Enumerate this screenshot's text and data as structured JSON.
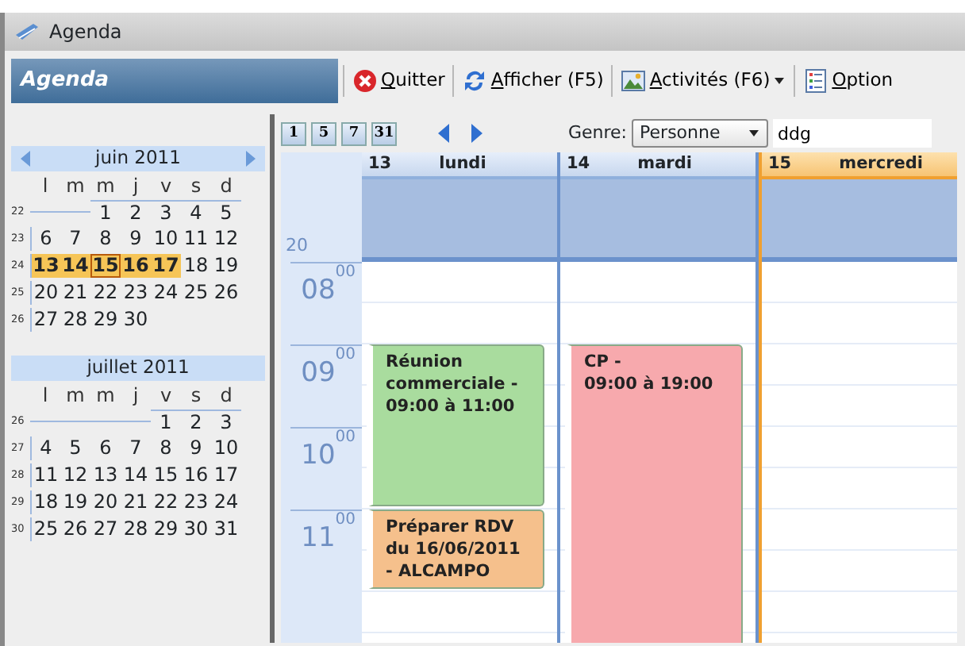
{
  "window": {
    "title": "Agenda"
  },
  "panel_title": "Agenda",
  "toolbar": [
    {
      "label": "Quitter",
      "kind": "quit"
    },
    {
      "label": "Afficher (F5)",
      "kind": "refresh"
    },
    {
      "label": "Activités  (F6)",
      "kind": "activities",
      "dropdown": true
    },
    {
      "label": "Option",
      "kind": "options"
    }
  ],
  "mini_calendars": [
    {
      "title": "juin 2011",
      "navigation": true,
      "weekdays": [
        "l",
        "m",
        "m",
        "j",
        "v",
        "s",
        "d"
      ],
      "weeks": [
        {
          "number": "22",
          "kind": "right_aligned",
          "days": [
            {
              "day": "1",
              "selected": false,
              "today": false
            },
            {
              "day": "2",
              "selected": false,
              "today": false
            },
            {
              "day": "3",
              "selected": false,
              "today": false
            },
            {
              "day": "4",
              "selected": false,
              "today": false
            },
            {
              "day": "5",
              "selected": false,
              "today": false
            }
          ]
        },
        {
          "number": "23",
          "days": [
            {
              "day": "6",
              "selected": false,
              "today": false
            },
            {
              "day": "7",
              "selected": false,
              "today": false
            },
            {
              "day": "8",
              "selected": false,
              "today": false
            },
            {
              "day": "9",
              "selected": false,
              "today": false
            },
            {
              "day": "10",
              "selected": false,
              "today": false
            },
            {
              "day": "11",
              "selected": false,
              "today": false
            },
            {
              "day": "12",
              "selected": false,
              "today": false
            }
          ]
        },
        {
          "number": "24",
          "days": [
            {
              "day": "13",
              "selected": true,
              "today": false
            },
            {
              "day": "14",
              "selected": true,
              "today": false
            },
            {
              "day": "15",
              "selected": true,
              "today": true
            },
            {
              "day": "16",
              "selected": true,
              "today": false
            },
            {
              "day": "17",
              "selected": true,
              "today": false
            },
            {
              "day": "18",
              "selected": false,
              "today": false
            },
            {
              "day": "19",
              "selected": false,
              "today": false
            }
          ]
        },
        {
          "number": "25",
          "days": [
            {
              "day": "20",
              "selected": false,
              "today": false
            },
            {
              "day": "21",
              "selected": false,
              "today": false
            },
            {
              "day": "22",
              "selected": false,
              "today": false
            },
            {
              "day": "23",
              "selected": false,
              "today": false
            },
            {
              "day": "24",
              "selected": false,
              "today": false
            },
            {
              "day": "25",
              "selected": false,
              "today": false
            },
            {
              "day": "26",
              "selected": false,
              "today": false
            }
          ]
        },
        {
          "number": "26",
          "days": [
            {
              "day": "27",
              "selected": false,
              "today": false
            },
            {
              "day": "28",
              "selected": false,
              "today": false
            },
            {
              "day": "29",
              "selected": false,
              "today": false
            },
            {
              "day": "30",
              "selected": false,
              "today": false
            }
          ]
        }
      ]
    },
    {
      "title": "juillet 2011",
      "navigation": false,
      "weekdays": [
        "l",
        "m",
        "m",
        "j",
        "v",
        "s",
        "d"
      ],
      "weeks": [
        {
          "number": "26",
          "kind": "right_aligned",
          "days": [
            {
              "day": "1",
              "selected": false,
              "today": false
            },
            {
              "day": "2",
              "selected": false,
              "today": false
            },
            {
              "day": "3",
              "selected": false,
              "today": false
            }
          ]
        },
        {
          "number": "27",
          "days": [
            {
              "day": "4",
              "selected": false,
              "today": false
            },
            {
              "day": "5",
              "selected": false,
              "today": false
            },
            {
              "day": "6",
              "selected": false,
              "today": false
            },
            {
              "day": "7",
              "selected": false,
              "today": false
            },
            {
              "day": "8",
              "selected": false,
              "today": false
            },
            {
              "day": "9",
              "selected": false,
              "today": false
            },
            {
              "day": "10",
              "selected": false,
              "today": false
            }
          ]
        },
        {
          "number": "28",
          "days": [
            {
              "day": "11",
              "selected": false,
              "today": false
            },
            {
              "day": "12",
              "selected": false,
              "today": false
            },
            {
              "day": "13",
              "selected": false,
              "today": false
            },
            {
              "day": "14",
              "selected": false,
              "today": false
            },
            {
              "day": "15",
              "selected": false,
              "today": false
            },
            {
              "day": "16",
              "selected": false,
              "today": false
            },
            {
              "day": "17",
              "selected": false,
              "today": false
            }
          ]
        },
        {
          "number": "29",
          "days": [
            {
              "day": "18",
              "selected": false,
              "today": false
            },
            {
              "day": "19",
              "selected": false,
              "today": false
            },
            {
              "day": "20",
              "selected": false,
              "today": false
            },
            {
              "day": "21",
              "selected": false,
              "today": false
            },
            {
              "day": "22",
              "selected": false,
              "today": false
            },
            {
              "day": "23",
              "selected": false,
              "today": false
            },
            {
              "day": "24",
              "selected": false,
              "today": false
            }
          ]
        },
        {
          "number": "30",
          "days": [
            {
              "day": "25",
              "selected": false,
              "today": false
            },
            {
              "day": "26",
              "selected": false,
              "today": false
            },
            {
              "day": "27",
              "selected": false,
              "today": false
            },
            {
              "day": "28",
              "selected": false,
              "today": false
            },
            {
              "day": "29",
              "selected": false,
              "today": false
            },
            {
              "day": "30",
              "selected": false,
              "today": false
            },
            {
              "day": "31",
              "selected": false,
              "today": false
            }
          ]
        }
      ]
    }
  ],
  "view_buttons": [
    "1",
    "5",
    "7",
    "31"
  ],
  "genre": {
    "label": "Genre:",
    "value": "Personne"
  },
  "search": {
    "value": "ddg"
  },
  "week_number": "20",
  "hours": [
    "08$^{00}$",
    "09$^{00}$",
    "10$^{00}$",
    "11$^{00}$"
  ],
  "days": [
    {
      "number": "13",
      "name": "lundi",
      "today": false,
      "slots": [
        {
          "kind": "free"
        },
        {
          "kind": "start",
          "event": {
            "text": "Réunion commerciale - 09:00 à 11:00",
            "color": "#a9dc9e"
          }
        },
        {
          "kind": "continue"
        },
        {
          "kind": "start",
          "event": {
            "text": "Préparer RDV du 16/06/2011 - ALCAMPO",
            "color": "#f5c08c"
          }
        }
      ]
    },
    {
      "number": "14",
      "name": "mardi",
      "today": false,
      "slots": [
        {
          "kind": "free"
        },
        {
          "kind": "start",
          "event": {
            "text": "CP -\n09:00 à 19:00",
            "color": "#f7a9ad"
          }
        },
        {
          "kind": "continue"
        },
        {
          "kind": "continue"
        }
      ]
    },
    {
      "number": "15",
      "name": "mercredi",
      "today": true,
      "slots": [
        {
          "kind": "free"
        },
        {
          "kind": "free"
        },
        {
          "kind": "free"
        },
        {
          "kind": "free"
        }
      ]
    }
  ]
}
